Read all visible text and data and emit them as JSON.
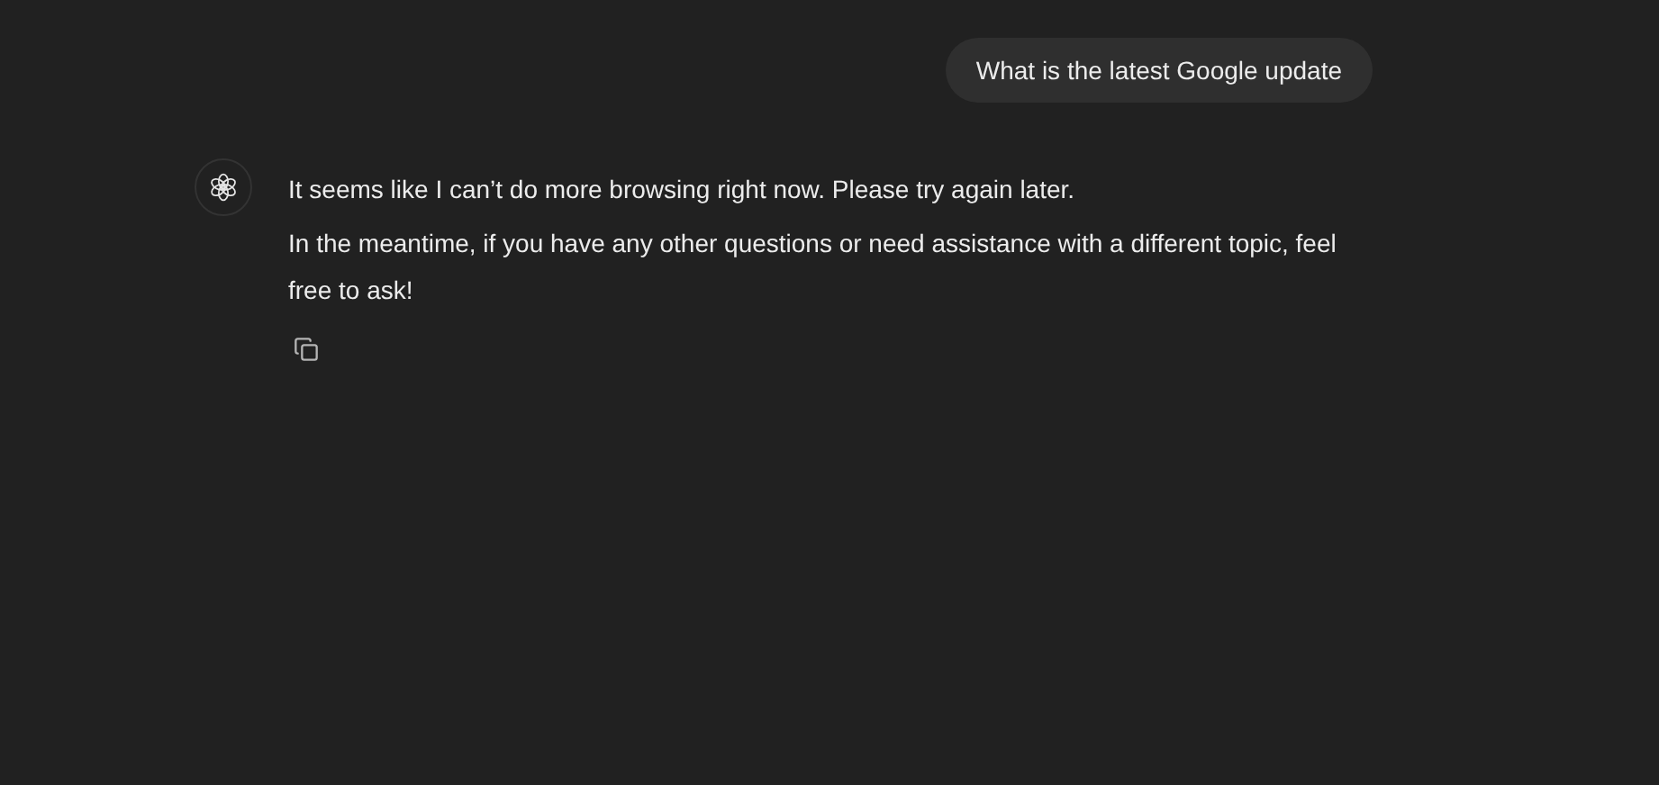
{
  "messages": [
    {
      "kind": "user",
      "paragraphs": [
        "What is the latest Google update"
      ]
    },
    {
      "kind": "assistant",
      "paragraphs": [
        "It seems like I can’t do more browsing right now. Please try again later.",
        "In the meantime, if you have any other questions or need assistance with a different topic, feel free to ask!"
      ]
    }
  ]
}
